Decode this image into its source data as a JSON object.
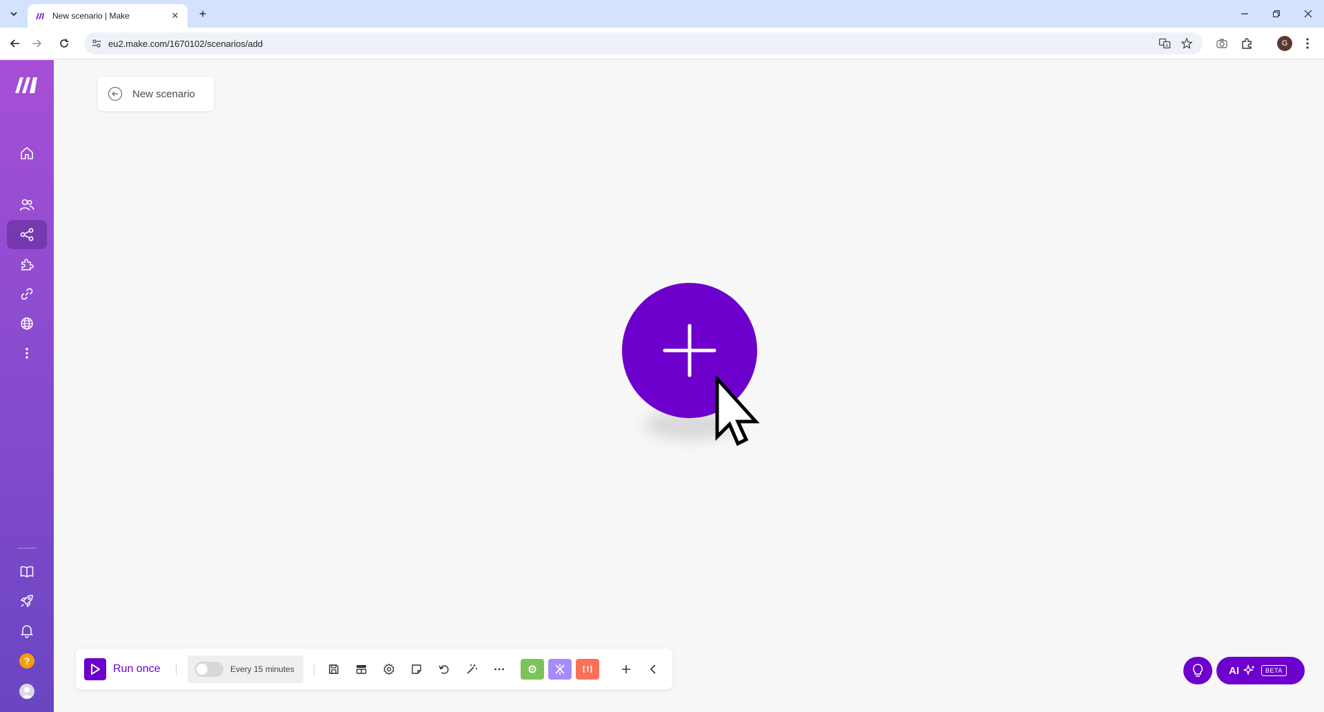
{
  "browser": {
    "tab_title": "New scenario | Make",
    "url": "eu2.make.com/1670102/scenarios/add",
    "profile_initial": "G"
  },
  "sidebar": {
    "items": [
      {
        "name": "home",
        "icon": "home-icon"
      },
      {
        "name": "team",
        "icon": "users-icon"
      },
      {
        "name": "scenarios",
        "icon": "share-icon",
        "active": true
      },
      {
        "name": "templates",
        "icon": "puzzle-icon"
      },
      {
        "name": "connections",
        "icon": "link-icon"
      },
      {
        "name": "webhooks",
        "icon": "globe-icon"
      },
      {
        "name": "more",
        "icon": "more-vertical-icon"
      },
      {
        "name": "resources",
        "icon": "book-icon"
      },
      {
        "name": "whats-new",
        "icon": "rocket-icon"
      },
      {
        "name": "notifications",
        "icon": "bell-icon"
      },
      {
        "name": "help",
        "icon": "help-icon",
        "label": "?"
      },
      {
        "name": "profile",
        "icon": "user-avatar"
      }
    ]
  },
  "canvas": {
    "scenario_name": "New scenario"
  },
  "toolbar": {
    "run_label": "Run once",
    "schedule_label": "Every 15 minutes",
    "schedule_enabled": false,
    "tools": [
      "save-icon",
      "scheduling-icon",
      "settings-icon",
      "notes-icon",
      "undo-icon",
      "magic-wand-icon",
      "more-horizontal-icon"
    ],
    "control_colors": {
      "tools": "#7cc35a",
      "flow_control": "#a78bfa",
      "text_parser": "#f87158"
    }
  },
  "assistant": {
    "ai_label": "AI",
    "beta_label": "BETA"
  },
  "colors": {
    "brand": "#6d00cc",
    "sidebar_top": "#a64fd6",
    "sidebar_bottom": "#6a46c2"
  }
}
